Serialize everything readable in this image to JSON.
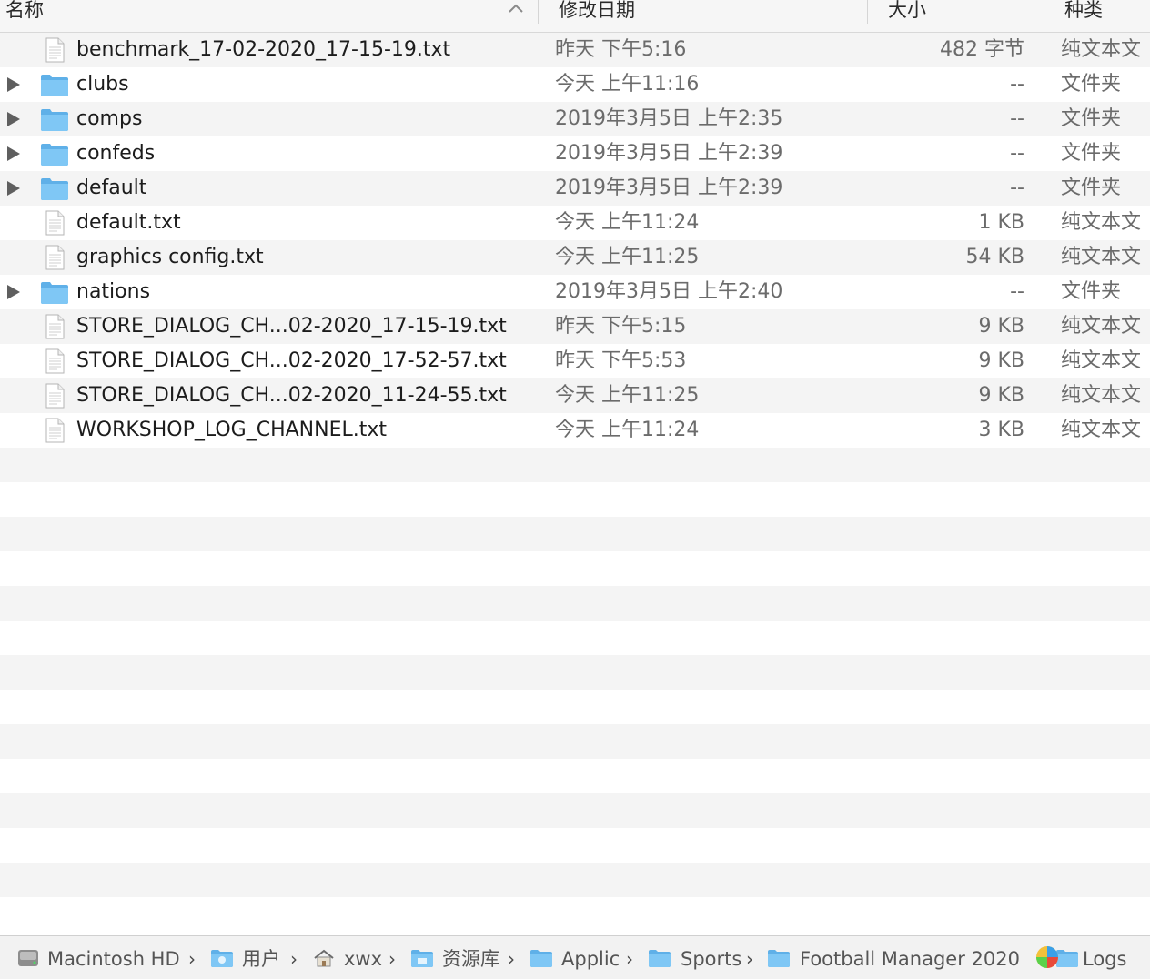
{
  "columns": {
    "name": "名称",
    "date": "修改日期",
    "size": "大小",
    "kind": "种类"
  },
  "colors": {
    "folder": "#7fc7f5",
    "folder_dark": "#5fb0e8",
    "row_alt": "#f4f4f4"
  },
  "rows": [
    {
      "type": "file",
      "name": "benchmark_17-02-2020_17-15-19.txt",
      "date": "昨天 下午5:16",
      "size": "482 字节",
      "kind": "纯文本文"
    },
    {
      "type": "folder",
      "name": "clubs",
      "date": "今天 上午11:16",
      "size": "--",
      "kind": "文件夹"
    },
    {
      "type": "folder",
      "name": "comps",
      "date": "2019年3月5日 上午2:35",
      "size": "--",
      "kind": "文件夹"
    },
    {
      "type": "folder",
      "name": "confeds",
      "date": "2019年3月5日 上午2:39",
      "size": "--",
      "kind": "文件夹"
    },
    {
      "type": "folder",
      "name": "default",
      "date": "2019年3月5日 上午2:39",
      "size": "--",
      "kind": "文件夹"
    },
    {
      "type": "file",
      "name": "default.txt",
      "date": "今天 上午11:24",
      "size": "1 KB",
      "kind": "纯文本文"
    },
    {
      "type": "file",
      "name": "graphics config.txt",
      "date": "今天 上午11:25",
      "size": "54 KB",
      "kind": "纯文本文"
    },
    {
      "type": "folder",
      "name": "nations",
      "date": "2019年3月5日 上午2:40",
      "size": "--",
      "kind": "文件夹"
    },
    {
      "type": "file",
      "name": "STORE_DIALOG_CH...02-2020_17-15-19.txt",
      "date": "昨天 下午5:15",
      "size": "9 KB",
      "kind": "纯文本文"
    },
    {
      "type": "file",
      "name": "STORE_DIALOG_CH...02-2020_17-52-57.txt",
      "date": "昨天 下午5:53",
      "size": "9 KB",
      "kind": "纯文本文"
    },
    {
      "type": "file",
      "name": "STORE_DIALOG_CH...02-2020_11-24-55.txt",
      "date": "今天 上午11:25",
      "size": "9 KB",
      "kind": "纯文本文"
    },
    {
      "type": "file",
      "name": "WORKSHOP_LOG_CHANNEL.txt",
      "date": "今天 上午11:24",
      "size": "3 KB",
      "kind": "纯文本文"
    }
  ],
  "pathbar": [
    {
      "label": "Macintosh HD",
      "icon": "hard-drive-icon"
    },
    {
      "label": "用户",
      "icon": "users-folder-icon"
    },
    {
      "label": "xwx",
      "icon": "home-icon"
    },
    {
      "label": "资源库",
      "icon": "library-folder-icon"
    },
    {
      "label": "Applic",
      "icon": "folder-icon"
    },
    {
      "label": "Sports",
      "icon": "folder-icon"
    },
    {
      "label": "Football Manager 2020",
      "icon": "folder-icon"
    },
    {
      "label": "Logs",
      "icon": "folder-icon"
    }
  ]
}
